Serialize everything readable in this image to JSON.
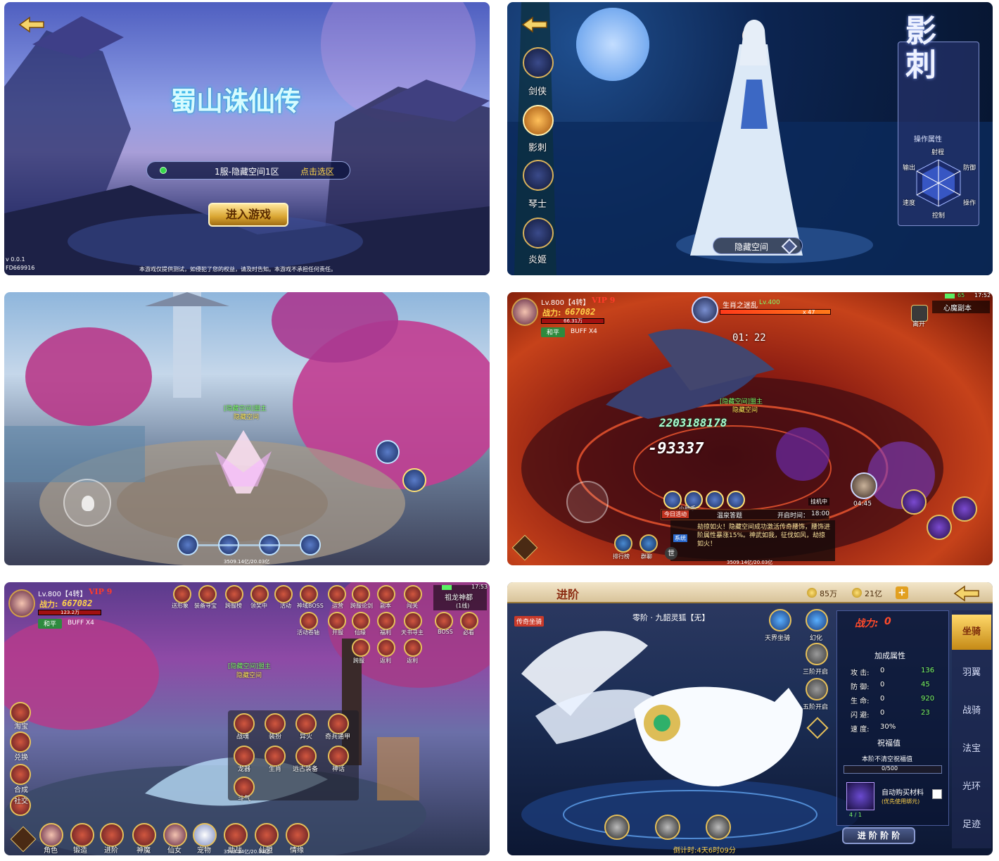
{
  "login": {
    "logo": "蜀山诛仙传",
    "server_name": "1服-隐藏空间1区",
    "select_server": "点击选区",
    "enter_button": "进入游戏",
    "version": "v 0.0.1",
    "build_id": "FD669916",
    "disclaimer": "本游戏仅提供测试，如侵犯了您的权益，请及时告知。本游戏不承担任何责任。"
  },
  "class_select": {
    "classes": [
      {
        "label": "剑侠"
      },
      {
        "label": "影刺"
      },
      {
        "label": "琴士"
      },
      {
        "label": "炎姬"
      }
    ],
    "selected_class_title": "影刺",
    "attribute_title": "操作属性",
    "radar_labels": {
      "top": "射程",
      "right_top": "防御",
      "right_bottom": "操作",
      "bottom": "控制",
      "left_bottom": "速度",
      "left_top": "输出"
    },
    "server_tag": "隐藏空间"
  },
  "field_scene": {
    "player_guild": "[隐藏空间]盟主",
    "player_name": "隐藏空间",
    "footer_stats": "3509.14亿/20.03亿"
  },
  "boss_fight": {
    "level": "Lv.800【4转】",
    "vip": "VIP 9",
    "power_label": "战力:",
    "power_value": "667082",
    "sub_power": "66.31万",
    "peace_mode": "和平",
    "buff": "BUFF X4",
    "boss_name": "生肖之迷乱",
    "boss_level": "Lv.400",
    "boss_hp_multiplier": "x 47",
    "timer": "01：22",
    "leave_label": "离开",
    "dungeon_name": "心魔副本",
    "battery": "65",
    "clock": "17:52",
    "damage_1": "2203188178",
    "damage_2": "-93337",
    "player_guild": "[隐藏空间]盟主",
    "player_name": "隐藏空间",
    "helper_label": "小助手",
    "today_activity": "今日活动",
    "activity_name": "温泉答题",
    "open_time_label": "开启时间：",
    "open_time": "18:00",
    "chat_tag": "系统",
    "chat_message": "劫掠如火！隐藏空间成功激活传奇腰饰，腰饰进阶属性暴涨15%。神武如我，征伐如风，劫掠如火！",
    "hang_label": "挂机中",
    "skill_cd": "04:45",
    "rank_label": "排行榜",
    "group_chat": "群聊",
    "world_label": "世",
    "footer_stats": "3509.14亿/20.03亿"
  },
  "town": {
    "level": "Lv.800【4转】",
    "vip": "VIP 9",
    "power_label": "战力:",
    "power_value": "667082",
    "sub_power": "123.2万",
    "peace_mode": "和平",
    "buff": "BUFF X4",
    "clock": "17:53",
    "map_name": "祖龙神都",
    "line": "(1线)",
    "top_icons": [
      "送形象",
      "装备寻宝",
      "跨服榜",
      "领奖中",
      "活动",
      "神域BOSS",
      "运营",
      "跨服论剑",
      "副本",
      "闯关"
    ],
    "second_icons": [
      "活动卷轴",
      "开服",
      "仙缘",
      "福利",
      "天书寻主",
      "BOSS",
      "必看",
      "跨服",
      "返利",
      "返利"
    ],
    "left_icons": [
      "淘宝",
      "兑换",
      "合成",
      "社交"
    ],
    "menu_grid": [
      "战魂",
      "装扮",
      "异火",
      "奇兵通甲",
      "龙器",
      "生肖",
      "远古装备",
      "神话",
      "斗气"
    ],
    "bottom_bar": [
      "角色",
      "锻造",
      "进阶",
      "神魔",
      "仙女",
      "宠物",
      "助战",
      "仙盟",
      "情缘"
    ],
    "player_guild": "[隐藏空间]盟主",
    "player_name": "隐藏空间",
    "footer_stats": "3509.14亿/20.03亿"
  },
  "mount": {
    "title": "进阶",
    "currency_1": "85万",
    "currency_2": "21亿",
    "tag": "传奇坐骑",
    "mount_name": "零阶 · 九韶灵狐【无】",
    "icons": [
      "天界坐骑",
      "幻化",
      "三阶开启",
      "五阶开启"
    ],
    "power_label": "战力:",
    "power_value": "0",
    "attr_title": "加成属性",
    "attributes": [
      {
        "name": "攻  击:",
        "value": "0",
        "gain": "136"
      },
      {
        "name": "防  御:",
        "value": "0",
        "gain": "45"
      },
      {
        "name": "生  命:",
        "value": "0",
        "gain": "920"
      },
      {
        "name": "闪  避:",
        "value": "0",
        "gain": "23"
      },
      {
        "name": "速  度:",
        "value": "30%",
        "gain": ""
      }
    ],
    "bless_title": "祝福值",
    "bless_note": "本阶不清空祝福值",
    "bless_value": "0/500",
    "auto_buy": "自动购买材料",
    "auto_buy_sub": "(优先使用绑元)",
    "item_count": "4 / 1",
    "advance_button": "进 阶   阶 阶",
    "time_left": "倒计时:4天6时09分",
    "side_tabs": [
      "坐骑",
      "羽翼",
      "战骑",
      "法宝",
      "光环",
      "足迹"
    ]
  }
}
